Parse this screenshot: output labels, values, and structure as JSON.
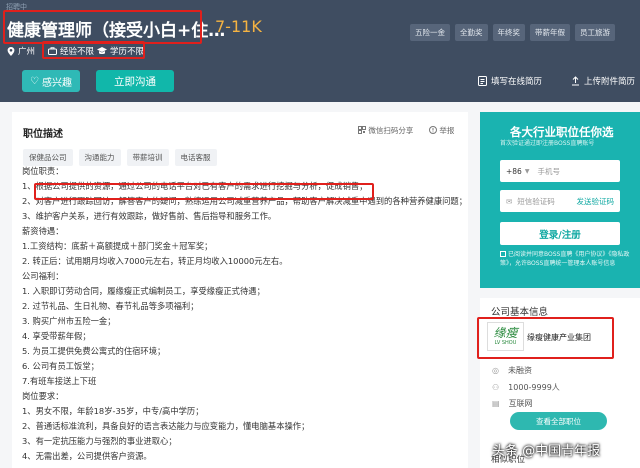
{
  "header": {
    "status": "招聘中",
    "title": "健康管理师（接受小白+住…",
    "salary": "7-11K",
    "city": "广州",
    "experience": "经验不限",
    "education": "学历不限",
    "benefit_tags": [
      "五险一金",
      "全勤奖",
      "年终奖",
      "带薪年假",
      "员工旅游"
    ],
    "interest_label": "感兴趣",
    "chat_label": "立即沟通",
    "online_resume": "填写在线简历",
    "upload_resume": "上传附件简历"
  },
  "main": {
    "section_title": "职位描述",
    "share": "微信扫码分享",
    "report": "举报",
    "tags": [
      "保健品公司",
      "沟通能力",
      "带薪培训",
      "电话客服"
    ],
    "lines": [
      "岗位职责：",
      "1、根据公司提供的资源，通过公司的电话平台对已有客户的需求进行挖掘与分析，促成销售；",
      "2、对客户进行跟踪回访，解答客户的疑问，熟练运用公司减重营养产品，帮助客户解决减重中遇到的各种营养健康问题；",
      "3、维护客户关系，进行有效跟踪，做好售前、售后指导和服务工作。",
      "薪资待遇：",
      "1.工资结构：底薪＋高额提成＋部门奖金＋冠军奖；",
      "2. 转正后：试用期月均收入7000元左右，转正月均收入10000元左右。",
      "公司福利：",
      "1. 入职即订劳动合同，履缘瘦正式编制员工，享受缘瘦正式待遇；",
      "2. 过节礼品、生日礼物、春节礼品等多项福利；",
      "3. 购买广州市五险一金；",
      "4. 享受带薪年假；",
      "5. 为员工提供免费公寓式的住宿环境；",
      "6. 公司有员工饭堂；",
      "7.有班车接送上下班",
      "岗位要求：",
      "1、男女不限，年龄18岁-35岁，中专/高中学历；",
      "2、普通话标准流利，具备良好的语言表达能力与应变能力，懂电脑基本操作；",
      "3、有一定抗压能力与强烈的事业进取心；",
      "4、无需出差，公司提供客户资源。"
    ]
  },
  "promo": {
    "title": "各大行业职位任你选",
    "subtitle": "首次验证通过即注册BOSS直聘账号",
    "country_code": "+86",
    "phone_placeholder": "手机号",
    "code_placeholder": "短信验证码",
    "send_code": "发送验证码",
    "login_button": "登录/注册",
    "note": "已阅读并同意BOSS直聘《用户协议》《隐私政策》，允许BOSS直聘统一管理本人账号信息"
  },
  "company": {
    "section_title": "公司基本信息",
    "logo_text": "缘瘦",
    "logo_sub": "LV SHOU",
    "name": "缘瘦健康产业集团",
    "funding": "未融资",
    "size": "1000-9999人",
    "industry": "互联网",
    "more_jobs": "查看全部职位",
    "related": "相似职位"
  },
  "watermark": "头条 @中国青年报",
  "colors": {
    "header_bg": "#3f4d61",
    "accent": "#11b7aa",
    "salary": "#f5b342",
    "highlight": "#e0201c"
  }
}
